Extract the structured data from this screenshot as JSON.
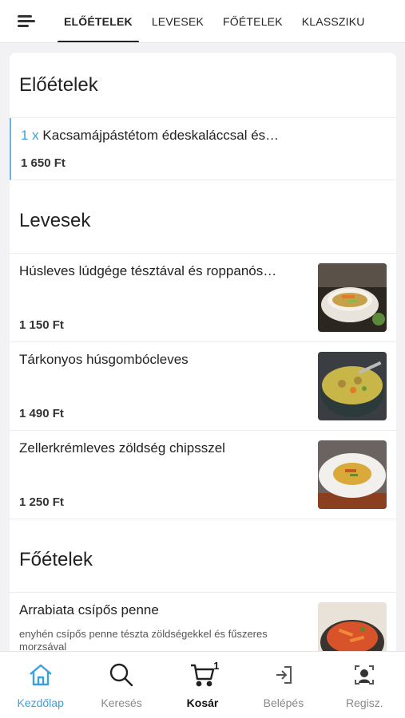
{
  "tabs": [
    "ELŐÉTELEK",
    "LEVESEK",
    "FŐÉTELEK",
    "KLASSZIKU"
  ],
  "sections": {
    "eloetelek": {
      "title": "Előételek",
      "cart_item": {
        "qty": "1 x",
        "name": "Kacsamájpástétom édeskaláccsal és…",
        "price": "1 650 Ft"
      }
    },
    "levesek": {
      "title": "Levesek",
      "items": [
        {
          "name": "Húsleves lúdgége tésztával és roppanós…",
          "price": "1 150 Ft"
        },
        {
          "name": "Tárkonyos húsgombócleves",
          "price": "1 490 Ft"
        },
        {
          "name": "Zellerkrémleves zöldség chipsszel",
          "price": "1 250 Ft"
        }
      ]
    },
    "foetelek": {
      "title": "Főételek",
      "items": [
        {
          "name": "Arrabiata csípős penne",
          "desc": "enyhén csípős penne tészta zöldségekkel és fűszeres morzsával"
        }
      ]
    }
  },
  "bottom_nav": {
    "home": "Kezdőlap",
    "search": "Keresés",
    "cart": "Kosár",
    "cart_count": "1",
    "login": "Belépés",
    "register": "Regisz."
  },
  "colors": {
    "accent": "#3aa0e0"
  }
}
